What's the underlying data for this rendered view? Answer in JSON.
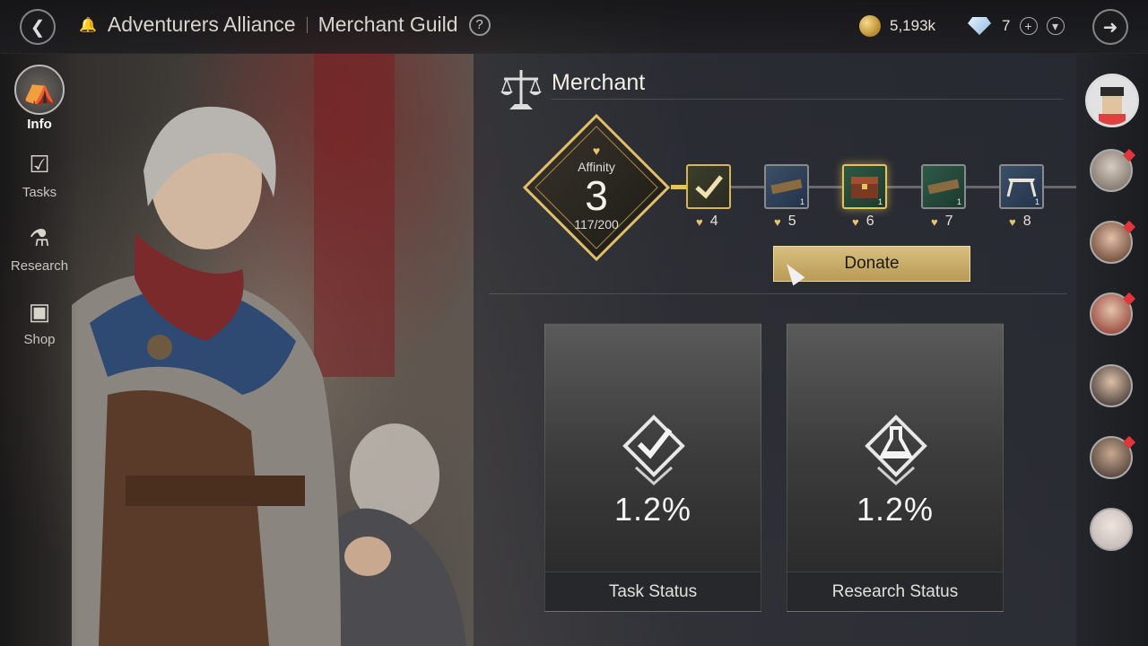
{
  "header": {
    "breadcrumb_1": "Adventurers Alliance",
    "breadcrumb_2": "Merchant Guild",
    "help": "?",
    "gold": "5,193k",
    "gems": "7"
  },
  "nav": {
    "items": [
      {
        "label": "Info",
        "icon": "tent-icon",
        "active": true
      },
      {
        "label": "Tasks",
        "icon": "checkbox-icon",
        "active": false
      },
      {
        "label": "Research",
        "icon": "flask-icon",
        "active": false
      },
      {
        "label": "Shop",
        "icon": "chest-icon",
        "active": false
      }
    ]
  },
  "merchant": {
    "title": "Merchant",
    "affinity_label": "Affinity",
    "affinity_level": "3",
    "affinity_progress": "117/200",
    "affinity_fraction": 0.585,
    "rewards": [
      {
        "level": "4",
        "icon": "check-reward-icon",
        "claimed": true
      },
      {
        "level": "5",
        "icon": "wood-plank-icon",
        "count": "1"
      },
      {
        "level": "6",
        "icon": "treasure-chest-icon",
        "count": "1"
      },
      {
        "level": "7",
        "icon": "wood-plank-icon",
        "count": "1"
      },
      {
        "level": "8",
        "icon": "table-icon",
        "count": "1"
      }
    ],
    "donate_label": "Donate"
  },
  "status": {
    "task_pct": "1.2%",
    "task_label": "Task Status",
    "research_pct": "1.2%",
    "research_label": "Research Status"
  },
  "colors": {
    "accent_gold": "#e6c35a",
    "badge_red": "#e0353a"
  }
}
